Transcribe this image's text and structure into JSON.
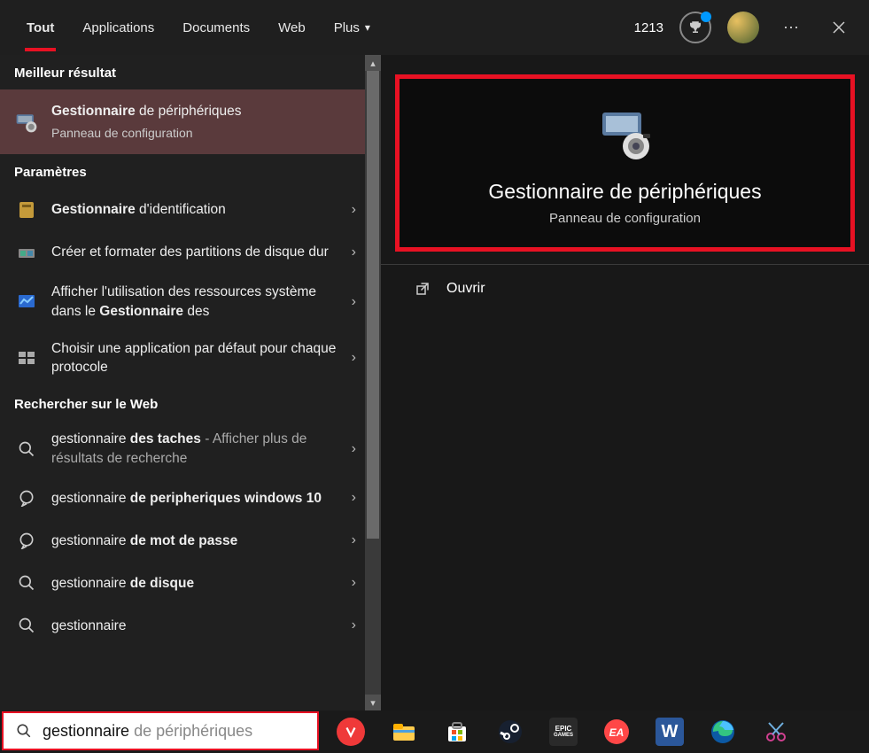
{
  "tabs": {
    "all": "Tout",
    "apps": "Applications",
    "docs": "Documents",
    "web": "Web",
    "more": "Plus"
  },
  "points": "1213",
  "sections": {
    "best": "Meilleur résultat",
    "settings": "Paramètres",
    "web": "Rechercher sur le Web"
  },
  "best": {
    "title_bold": "Gestionnaire",
    "title_rest": " de périphériques",
    "sub": "Panneau de configuration"
  },
  "settings_items": [
    {
      "bold": "Gestionnaire",
      "rest": " d'identification"
    },
    {
      "pre": "Créer et formater des partitions de disque dur"
    },
    {
      "pre": "Afficher l'utilisation des ressources système dans le ",
      "bold": "Gestionnaire",
      "rest": " des"
    },
    {
      "pre": "Choisir une application par défaut pour chaque protocole"
    }
  ],
  "web_items": [
    {
      "pre": "gestionnaire ",
      "bold": "des taches",
      "suffix": " - Afficher plus de résultats de recherche"
    },
    {
      "pre": "gestionnaire ",
      "bold": "de peripheriques windows 10"
    },
    {
      "pre": "gestionnaire ",
      "bold": "de mot de passe"
    },
    {
      "pre": "gestionnaire ",
      "bold": "de disque"
    },
    {
      "pre": "gestionnaire"
    }
  ],
  "preview": {
    "title": "Gestionnaire de périphériques",
    "sub": "Panneau de configuration",
    "open": "Ouvrir"
  },
  "search": {
    "typed": "gestionnaire",
    "ghost": " de périphériques"
  }
}
